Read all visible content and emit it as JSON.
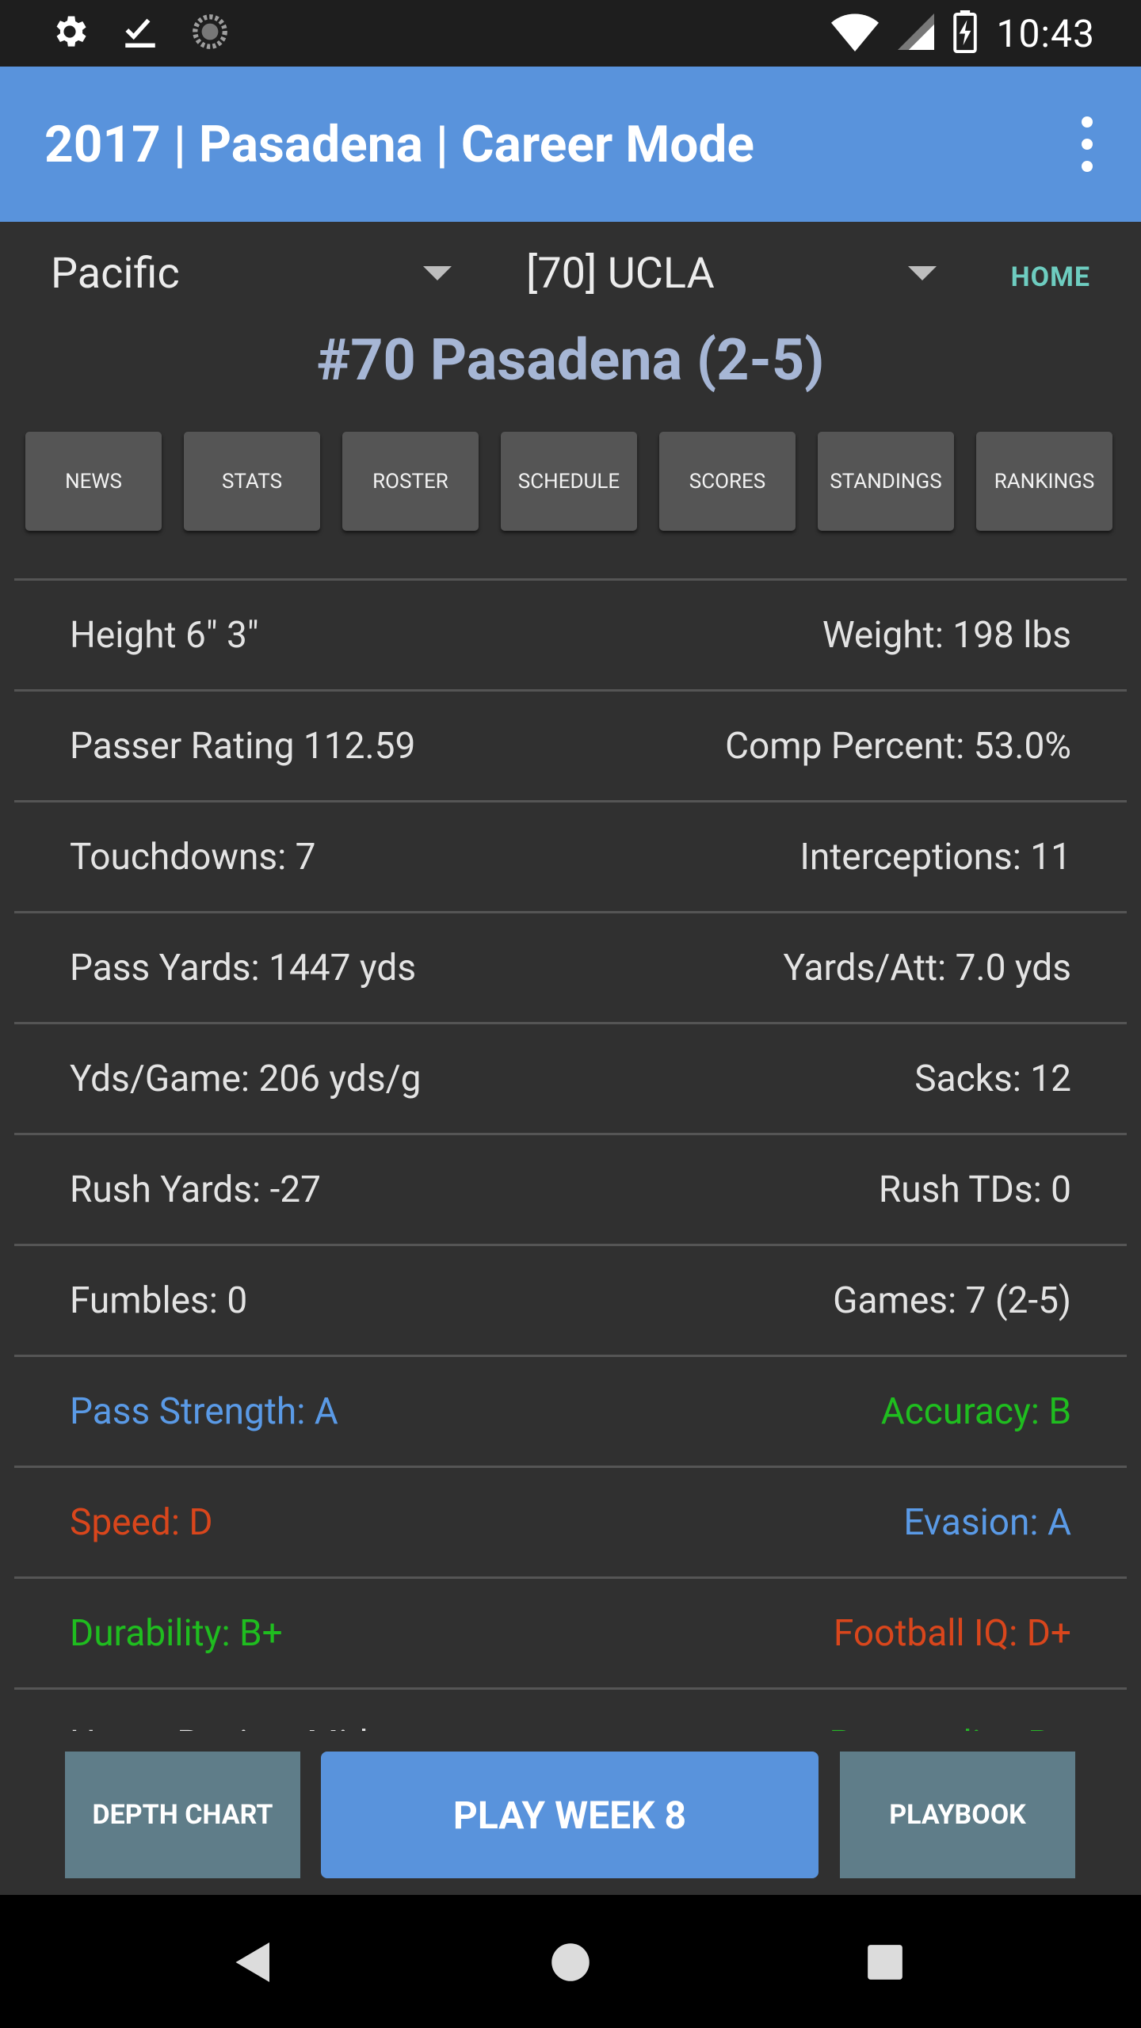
{
  "status_bar": {
    "time": "10:43",
    "icons": [
      "gear-icon",
      "checkmark-download-icon",
      "sync-icon",
      "wifi-icon",
      "signal-icon",
      "battery-charging-icon"
    ]
  },
  "app_bar": {
    "title": "2017 | Pasadena | Career Mode",
    "menu_icon": "more-vert-icon"
  },
  "selectors": {
    "conference": "Pacific",
    "team": "[70] UCLA",
    "home_label": "HOME"
  },
  "team_header": "#70 Pasadena (2-5)",
  "tabs": [
    "NEWS",
    "STATS",
    "ROSTER",
    "SCHEDULE",
    "SCORES",
    "STANDINGS",
    "RANKINGS"
  ],
  "stats": [
    {
      "left": "Height 6\" 3\"",
      "right": "Weight: 198 lbs"
    },
    {
      "left": "Passer Rating 112.59",
      "right": "Comp Percent: 53.0%"
    },
    {
      "left": "Touchdowns: 7",
      "right": "Interceptions: 11"
    },
    {
      "left": "Pass Yards: 1447 yds",
      "right": "Yards/Att: 7.0 yds"
    },
    {
      "left": "Yds/Game: 206 yds/g",
      "right": "Sacks: 12"
    },
    {
      "left": "Rush Yards: -27",
      "right": "Rush TDs: 0"
    },
    {
      "left": "Fumbles: 0",
      "right": "Games: 7 (2-5)"
    },
    {
      "left": "Pass Strength: A",
      "right": "Accuracy: B"
    },
    {
      "left": "Speed: D",
      "right": "Evasion: A"
    },
    {
      "left": "Durability: B+",
      "right": "Football IQ: D+"
    },
    {
      "left": "Home Region: Midwest",
      "right": "Personality: B+"
    }
  ],
  "colors": {
    "grade_a": "#5a9ae6",
    "grade_b": "#1fbd1f",
    "grade_d": "#d9461c",
    "accent": "#5993dc"
  },
  "bottom_buttons": {
    "depth_chart": "DEPTH CHART",
    "play": "PLAY WEEK 8",
    "playbook": "PLAYBOOK"
  },
  "nav_bar": [
    "back-icon",
    "home-icon",
    "recents-icon"
  ]
}
